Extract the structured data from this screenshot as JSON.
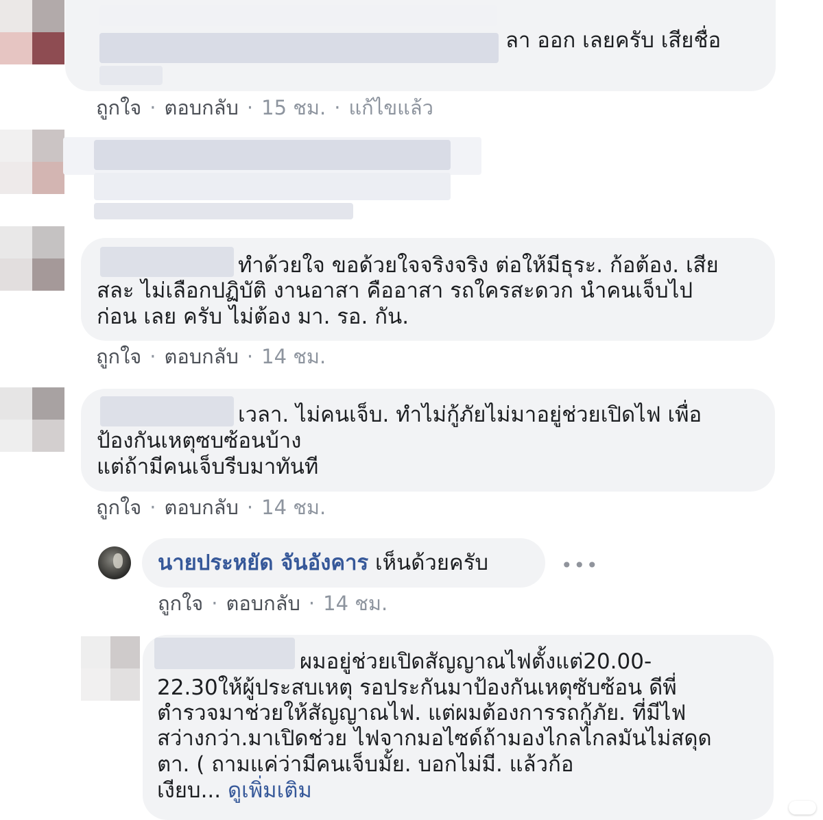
{
  "comments": [
    {
      "text_lines": [
        "ลา ออก เลยครับ เสียชื่อ"
      ],
      "actions": {
        "like": "ถูกใจ",
        "reply": "ตอบกลับ",
        "time": "15 ชม.",
        "edited": "แก้ไขแล้ว"
      }
    },
    {
      "text_lines": []
    },
    {
      "text_lines": [
        "ทำด้วยใจ ขอด้วยใจจริงจริง ต่อให้มีธุระ. ก้อต้อง. เสีย",
        "สละ ไม่เลือกปฏิบัติ งานอาสา คืออาสา รถใครสะดวก นำคนเจ็บไป",
        "ก่อน เลย ครับ ไม่ต้อง มา. รอ. กัน."
      ],
      "actions": {
        "like": "ถูกใจ",
        "reply": "ตอบกลับ",
        "time": "14 ชม."
      }
    },
    {
      "text_lines": [
        "เวลา. ไม่คนเจ็บ. ทำไม่กู้ภัยไม่มาอยู่ช่วยเปิดไฟ เพื่อ",
        "ป้องกันเหตุซบซ้อนบ้าง",
        "แต่ถ้ามีคนเจ็บรีบมาทันที"
      ],
      "actions": {
        "like": "ถูกใจ",
        "reply": "ตอบกลับ",
        "time": "14 ชม."
      }
    }
  ],
  "reply": {
    "author": "นายประหยัด จันอังคาร",
    "text": "เห็นด้วยครับ",
    "more_icon": "•••",
    "actions": {
      "like": "ถูกใจ",
      "reply": "ตอบกลับ",
      "time": "14 ชม."
    }
  },
  "last_comment": {
    "text_lines": [
      "ผมอยู่ช่วยเปิดสัญญาณไฟตั้งแต่20.00-",
      "22.30ให้ผู้ประสบเหตุ รอประกันมาป้องกันเหตุซับซ้อน ดีพี่",
      "ตำรวจมาช่วยให้สัญญาณไฟ. แต่ผมต้องการรถกู้ภัย. ที่มีไฟ",
      "สว่างกว่า.มาเปิดช่วย ไฟจากมอไซด์ถ้ามองไกลไกลมันไม่สดุด",
      "ตา. ( ถามแค่ว่ามีคนเจ็บมั้ย. บอกไม่มี. แล้วก้อ"
    ],
    "truncated_prefix": "เงียบ... ",
    "see_more": "ดูเพิ่มเติม"
  },
  "colors": {
    "bubble": "#f2f3f5",
    "link": "#365899",
    "meta": "#8d949e"
  }
}
